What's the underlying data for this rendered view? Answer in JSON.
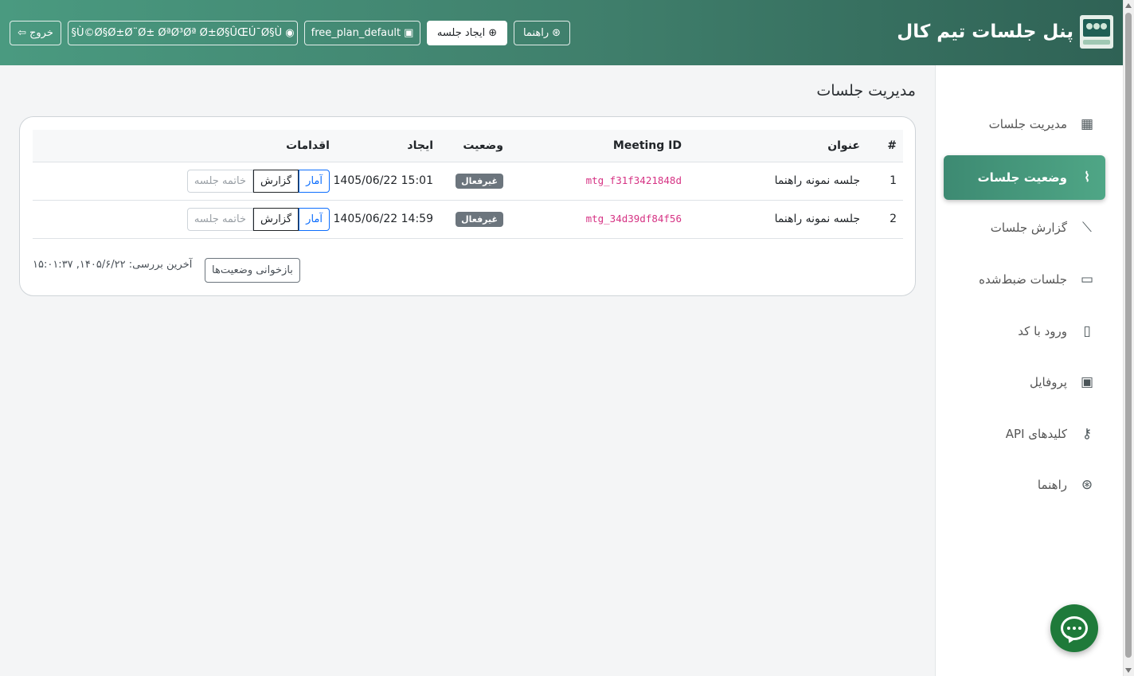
{
  "header": {
    "brand_title": "پنل جلسات تیم کال",
    "buttons": {
      "help": {
        "label": "راهنما",
        "icon": "life-ring-icon"
      },
      "create": {
        "label": "ایجاد جلسه",
        "icon": "plus-circle-icon"
      },
      "plan": {
        "label": "free_plan_default",
        "icon": "gift-icon"
      },
      "user": {
        "label": "§Ù©Ø§Ø±Ø¨Ø± ØªØ³Øª Ø±Ø§ÛŒÚ¯Ø§Ù",
        "icon": "user-circle-icon"
      },
      "logout": {
        "label": "خروج",
        "icon": "logout-icon"
      }
    }
  },
  "sidebar": {
    "items": [
      {
        "label": "مدیریت جلسات",
        "icon": "grid-icon"
      },
      {
        "label": "وضعیت جلسات",
        "icon": "activity-icon",
        "active": true
      },
      {
        "label": "گزارش جلسات",
        "icon": "chart-line-icon"
      },
      {
        "label": "جلسات ضبط‌شده",
        "icon": "camera-video-icon"
      },
      {
        "label": "ورود با کد",
        "icon": "door-icon"
      },
      {
        "label": "پروفایل",
        "icon": "person-badge-icon"
      },
      {
        "label": "کلیدهای API",
        "icon": "key-icon"
      },
      {
        "label": "راهنما",
        "icon": "life-ring-icon"
      }
    ]
  },
  "main": {
    "page_title": "مدیریت جلسات",
    "table": {
      "headers": [
        "#",
        "عنوان",
        "Meeting ID",
        "وضعیت",
        "ایجاد",
        "اقدامات"
      ],
      "rows": [
        {
          "num": "1",
          "title": "جلسه نمونه راهنما",
          "meeting_id": "mtg_f31f3421848d",
          "status": "غیرفعال",
          "created": "1405/06/22 15:01"
        },
        {
          "num": "2",
          "title": "جلسه نمونه راهنما",
          "meeting_id": "mtg_34d39df84f56",
          "status": "غیرفعال",
          "created": "1405/06/22 14:59"
        }
      ],
      "actions": {
        "stats": "آمار",
        "report": "گزارش",
        "end": "خاتمه جلسه"
      }
    },
    "refresh_label": "بازخوانی وضعیت‌ها",
    "last_check": "آخرین بررسی: ۱۴۰۵/۶/۲۲, ۱۵:۰۱:۳۷"
  },
  "chat": {
    "icon": "chat-icon"
  },
  "colors": {
    "header_start": "#4a9a80",
    "header_end": "#2f6255",
    "accent": "#3d8a72",
    "badge": "#6c757d",
    "mono_id": "#d63384"
  }
}
